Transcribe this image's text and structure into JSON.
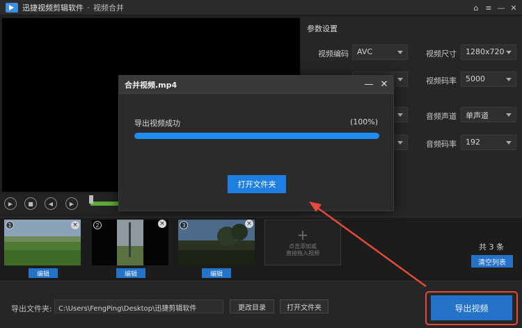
{
  "window": {
    "app_title": "迅捷视频剪辑软件",
    "separator": "-",
    "page_name": "视频合并"
  },
  "params": {
    "title": "参数设置",
    "rows": [
      {
        "label": "视频编码",
        "value": "AVC"
      },
      {
        "label": "视频尺寸",
        "value": "1280x720"
      },
      {
        "label": "视频码率",
        "value": "5000"
      },
      {
        "label": "音频声道",
        "value": "单声道"
      },
      {
        "label": "音频码率",
        "value": "192"
      }
    ]
  },
  "clips": [
    {
      "number": "1",
      "edit_label": "编辑"
    },
    {
      "number": "2",
      "edit_label": "编辑"
    },
    {
      "number": "3",
      "edit_label": "编辑"
    }
  ],
  "add_video": {
    "line1": "点击添加或",
    "line2": "直接拖入视频"
  },
  "clip_count": "共 3 条",
  "clear_list_label": "清空列表",
  "output": {
    "label": "导出文件夹:",
    "path": "C:\\Users\\FengPing\\Desktop\\迅捷剪辑软件",
    "change_dir_label": "更改目录",
    "open_folder_label": "打开文件夹"
  },
  "export_label": "导出视频",
  "dialog": {
    "title": "合并视频.mp4",
    "status": "导出视频成功",
    "percent_text": "(100%)",
    "progress": 1.0,
    "open_folder_label": "打开文件夹"
  },
  "colors": {
    "accent": "#2473c8",
    "progress": "#1f8df0",
    "highlight": "#e64a3a"
  }
}
